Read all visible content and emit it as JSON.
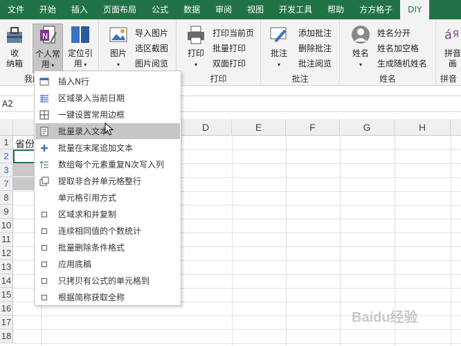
{
  "tabs": [
    "文件",
    "开始",
    "插入",
    "页面布局",
    "公式",
    "数据",
    "审阅",
    "视图",
    "开发工具",
    "帮助",
    "方方格子",
    "DIY"
  ],
  "active_tab": "DIY",
  "ribbon": {
    "shoukuan": [
      "收",
      "纳箱"
    ],
    "geren": [
      "个人常",
      "用"
    ],
    "dingwei": [
      "定位引",
      "用"
    ],
    "group_mine": "我的",
    "picture": "图片",
    "import_pic": "导入图片",
    "select_screenshot": "选区截图",
    "pic_browse": "图片阅览",
    "print": "打印",
    "print_current": "打印当前页",
    "batch_print": "批量打印",
    "duplex_print": "双面打印",
    "group_print": "打印",
    "annotate": "批注",
    "add_comment": "添加批注",
    "delete_comment": "删除批注",
    "browse_comment": "批注阅览",
    "group_annotate": "批注",
    "name": "姓名",
    "split_name": "姓名分开",
    "name_space": "姓名加空格",
    "random_name": "生成随机姓名",
    "group_name": "姓名",
    "pinyin": [
      "拼音",
      "画"
    ],
    "group_pinyin": "拼音"
  },
  "namebox": "A2",
  "columns": [
    "D",
    "E",
    "F",
    "G",
    "H"
  ],
  "rows": [
    "1",
    "2",
    "3",
    "7",
    "8",
    "9",
    "10",
    "11",
    "12",
    "13",
    "14",
    "15",
    "16",
    "17",
    "18"
  ],
  "cell_a1": "省份",
  "menu": [
    {
      "label": "插入N行",
      "icon": "insert-rows-icon"
    },
    {
      "label": "区域录入当前日期",
      "icon": "date-list-icon"
    },
    {
      "label": "一键设置常用边框",
      "icon": "border-icon"
    },
    {
      "label": "批量录入文本",
      "icon": "batch-text-icon"
    },
    {
      "label": "批量在末尾追加文本",
      "icon": "plus-icon"
    },
    {
      "label": "数组每个元素重复N次写入列",
      "icon": "repeat-icon"
    },
    {
      "label": "提取非合并单元格整行",
      "icon": "extract-icon"
    },
    {
      "label": "单元格引用方式",
      "icon": ""
    },
    {
      "label": "区域求和并复制",
      "icon": "checkbox-icon"
    },
    {
      "label": "连续相同值的个数统计",
      "icon": "checkbox-icon"
    },
    {
      "label": "批量删除条件格式",
      "icon": "checkbox-icon"
    },
    {
      "label": "应用底稿",
      "icon": "checkbox-icon"
    },
    {
      "label": "只拷贝有公式的单元格到",
      "icon": "checkbox-icon"
    },
    {
      "label": "根据简称获取全称",
      "icon": "checkbox-icon"
    }
  ],
  "hover_index": 3,
  "watermark": "Baidu经验",
  "colors": {
    "accent": "#217346",
    "hover": "#c6c6c6"
  }
}
